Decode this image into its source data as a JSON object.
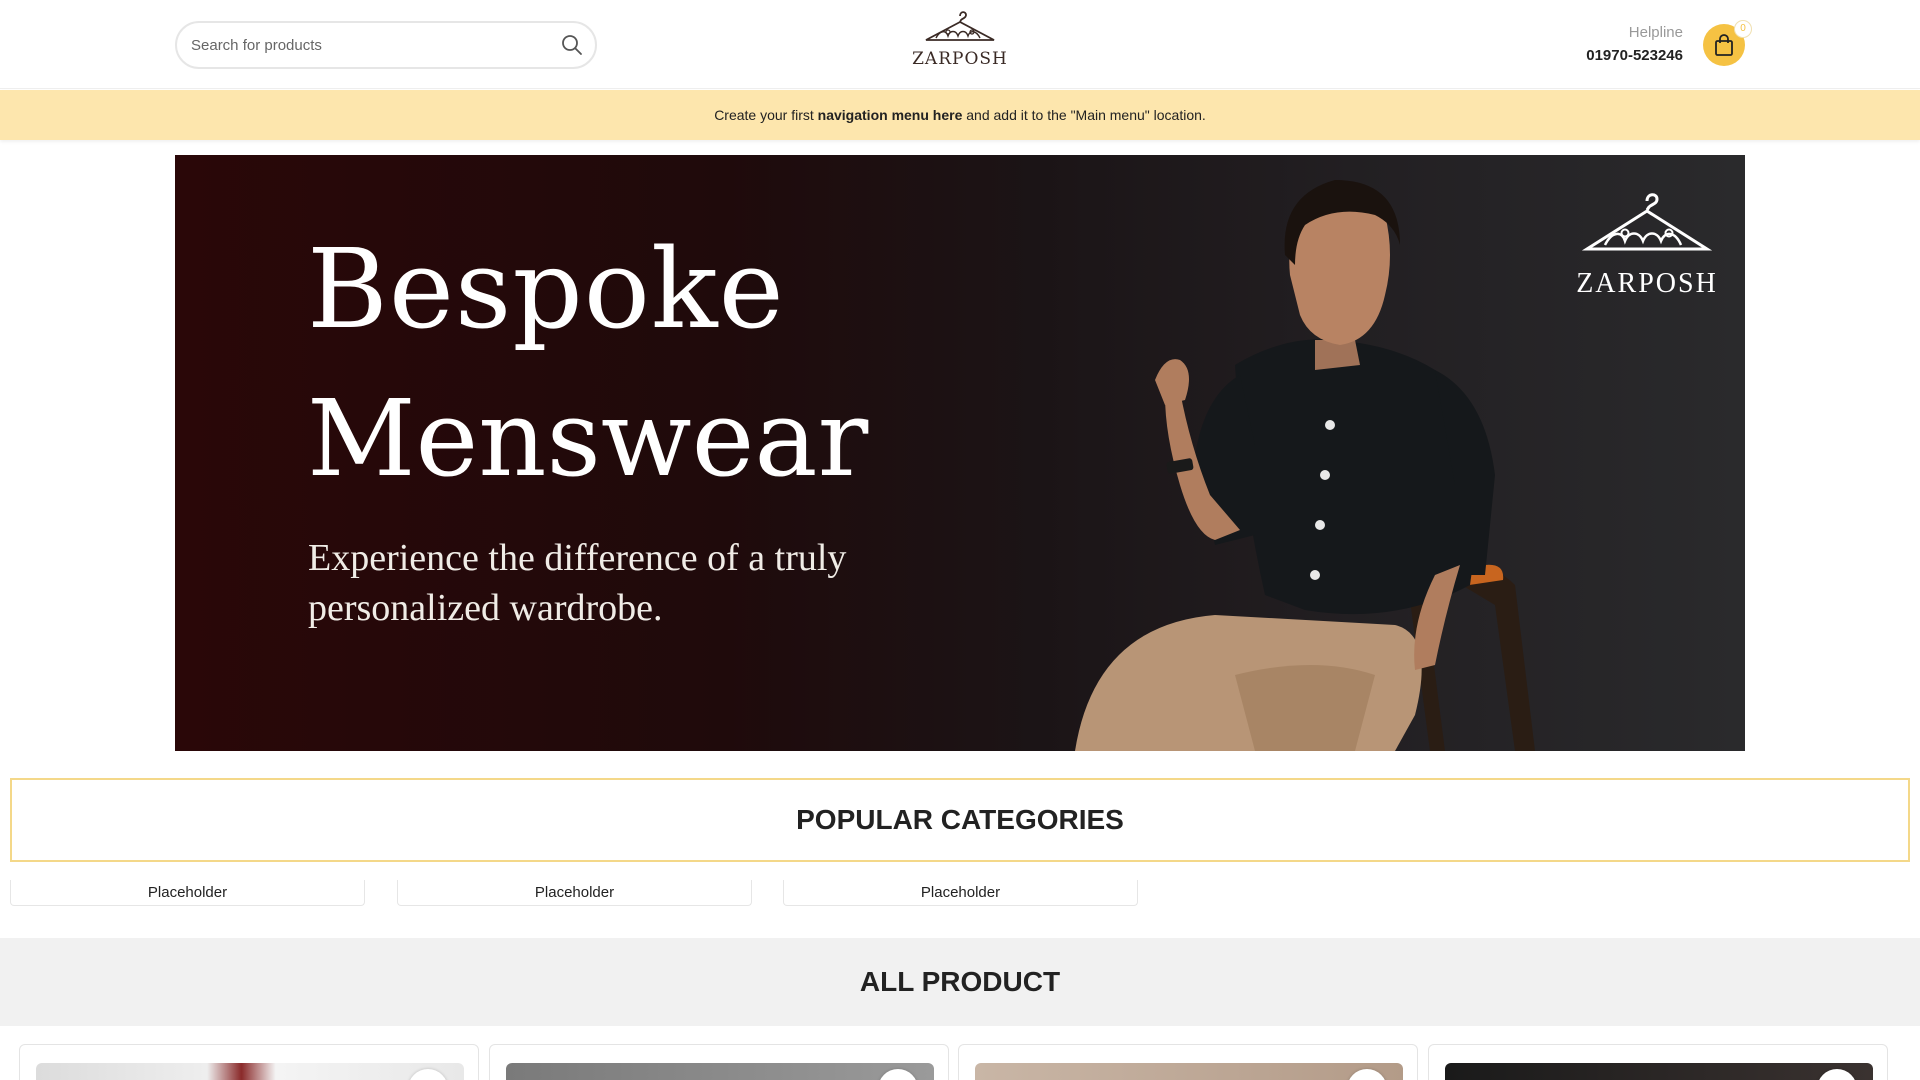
{
  "header": {
    "search": {
      "placeholder": "Search for products",
      "icon": "search-icon"
    },
    "logo": {
      "text": "ZARPOSH",
      "icon": "hanger-logo-icon"
    },
    "helpline": {
      "label": "Helpline",
      "number": "01970-523246"
    },
    "cart": {
      "count": "0",
      "icon": "shopping-bag-icon",
      "color": "#f5c243"
    }
  },
  "notice": {
    "prefix": "Create your first",
    "link": "navigation menu here",
    "suffix": "and add it to the \"Main menu\" location.",
    "background": "#fde6ad"
  },
  "hero": {
    "title_line1": "Bespoke",
    "title_line2": "Menswear",
    "subtitle": "Experience the difference of  a truly personalized wardrobe.",
    "brand": "ZARPOSH"
  },
  "popular_categories": {
    "heading": "POPULAR CATEGORIES",
    "items": [
      {
        "alt": "Placeholder"
      },
      {
        "alt": "Placeholder"
      },
      {
        "alt": "Placeholder"
      }
    ]
  },
  "all_product": {
    "heading": "ALL PRODUCT"
  }
}
